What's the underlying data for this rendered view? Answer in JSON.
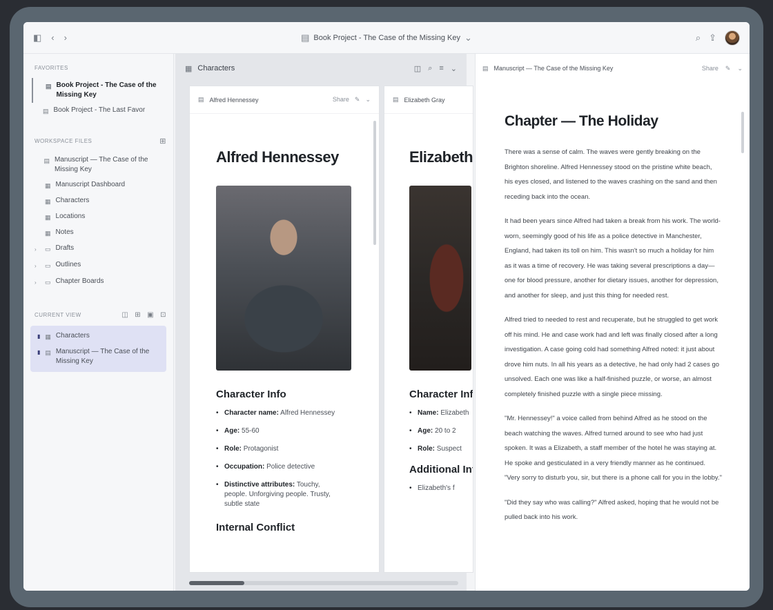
{
  "topbar": {
    "title": "Book Project - The Case of the Missing Key",
    "chevron": "⌄"
  },
  "sidebar": {
    "favorites_label": "Favorites",
    "favorites": [
      {
        "label": "Book Project - The Case of the Missing Key",
        "active": true
      },
      {
        "label": "Book Project - The Last Favor",
        "active": false
      }
    ],
    "workspace_label": "Workspace Files",
    "workspace": [
      {
        "label": "Manuscript — The Case of the Missing Key",
        "caret": ""
      },
      {
        "label": "Manuscript Dashboard",
        "caret": ""
      },
      {
        "label": "Characters",
        "caret": ""
      },
      {
        "label": "Locations",
        "caret": ""
      },
      {
        "label": "Notes",
        "caret": ""
      },
      {
        "label": "Drafts",
        "caret": "›"
      },
      {
        "label": "Outlines",
        "caret": "›"
      },
      {
        "label": "Chapter Boards",
        "caret": "›"
      }
    ],
    "pinned_label": "Current View",
    "pinned": [
      {
        "label": "Characters"
      },
      {
        "label": "Manuscript — The Case of the Missing Key"
      }
    ]
  },
  "characters_pane": {
    "title": "Characters",
    "cards": [
      {
        "tab_label": "Alfred Hennessey",
        "tools_label": "Share",
        "name": "Alfred Hennessey",
        "info_title": "Character Info",
        "info": [
          {
            "key": "Character name:",
            "value": "Alfred Hennessey"
          },
          {
            "key": "Age:",
            "value": "55-60"
          },
          {
            "key": "Role:",
            "value": "Protagonist"
          },
          {
            "key": "Occupation:",
            "value": "Police detective"
          },
          {
            "key": "Distinctive attributes:",
            "value": "Touchy, people. Unforgiving people. Trusty, subtle state"
          }
        ],
        "conflict_title": "Internal Conflict"
      },
      {
        "tab_label": "Elizabeth Gray",
        "name": "Elizabeth",
        "info_title": "Character Info",
        "info": [
          {
            "key": "Name:",
            "value": "Elizabeth"
          },
          {
            "key": "Age:",
            "value": "20 to 2"
          },
          {
            "key": "Role:",
            "value": "Suspect"
          }
        ],
        "extra_title": "Additional Info",
        "extra": [
          {
            "key": "",
            "value": "Elizabeth's f"
          }
        ]
      }
    ]
  },
  "manuscript_pane": {
    "title": "Manuscript — The Case of the Missing Key",
    "tools_label": "Share",
    "chapter": "Chapter — The Holiday",
    "paragraphs": [
      "There was a sense of calm. The waves were gently breaking on the Brighton shoreline. Alfred Hennessey stood on the pristine white beach, his eyes closed, and listened to the waves crashing on the sand and then receding back into the ocean.",
      "It had been years since Alfred had taken a break from his work. The world-worn, seemingly good of his life as a police detective in Manchester, England, had taken its toll on him. This wasn't so much a holiday for him as it was a time of recovery. He was taking several prescriptions a day—one for blood pressure, another for dietary issues, another for depression, and another for sleep, and just this thing for needed rest.",
      "Alfred tried to needed to rest and recuperate, but he struggled to get work off his mind. He and case work had and left was finally closed after a long investigation. A case going cold had something Alfred noted: it just about drove him nuts. In all his years as a detective, he had only had 2 cases go unsolved. Each one was like a half-finished puzzle, or worse, an almost completely finished puzzle with a single piece missing.",
      "\"Mr. Hennessey!\" a voice called from behind Alfred as he stood on the beach watching the waves. Alfred turned around to see who had just spoken. It was a Elizabeth, a staff member of the hotel he was staying at. He spoke and gesticulated in a very friendly manner as he continued. \"Very sorry to disturb you, sir, but there is a phone call for you in the lobby.\"",
      "\"Did they say who was calling?\" Alfred asked, hoping that he would not be pulled back into his work."
    ]
  }
}
